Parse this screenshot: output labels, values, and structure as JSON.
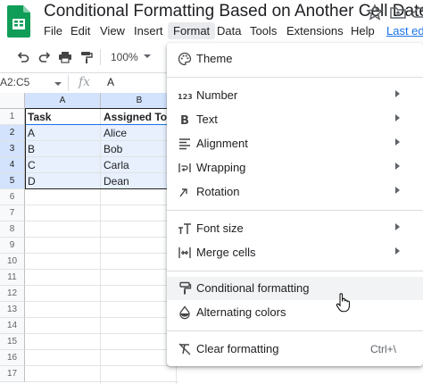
{
  "app": {
    "doc_title": "Conditional Formatting Based on Another Cell Date",
    "brand_color": "#0f9d58"
  },
  "menubar": {
    "items": [
      "File",
      "Edit",
      "View",
      "Insert",
      "Format",
      "Data",
      "Tools",
      "Extensions",
      "Help"
    ],
    "last_edit": "Last edi"
  },
  "toolbar": {
    "zoom": "100%"
  },
  "formula_bar": {
    "name_box": "A2:C5",
    "fx": "fx",
    "value": "A"
  },
  "grid": {
    "columns": [
      "A",
      "B"
    ],
    "rows": [
      "1",
      "2",
      "3",
      "4",
      "5",
      "6",
      "7",
      "8",
      "9",
      "10",
      "11",
      "12",
      "13",
      "14",
      "15",
      "16",
      "17"
    ],
    "header": [
      "Task",
      "Assigned To"
    ],
    "data": [
      [
        "A",
        "Alice"
      ],
      [
        "B",
        "Bob"
      ],
      [
        "C",
        "Carla"
      ],
      [
        "D",
        "Dean"
      ]
    ]
  },
  "format_menu": {
    "theme": "Theme",
    "number": "Number",
    "text": "Text",
    "alignment": "Alignment",
    "wrapping": "Wrapping",
    "rotation": "Rotation",
    "font_size": "Font size",
    "merge_cells": "Merge cells",
    "conditional_formatting": "Conditional formatting",
    "alternating_colors": "Alternating colors",
    "clear_formatting": "Clear formatting",
    "clear_shortcut": "Ctrl+\\"
  }
}
